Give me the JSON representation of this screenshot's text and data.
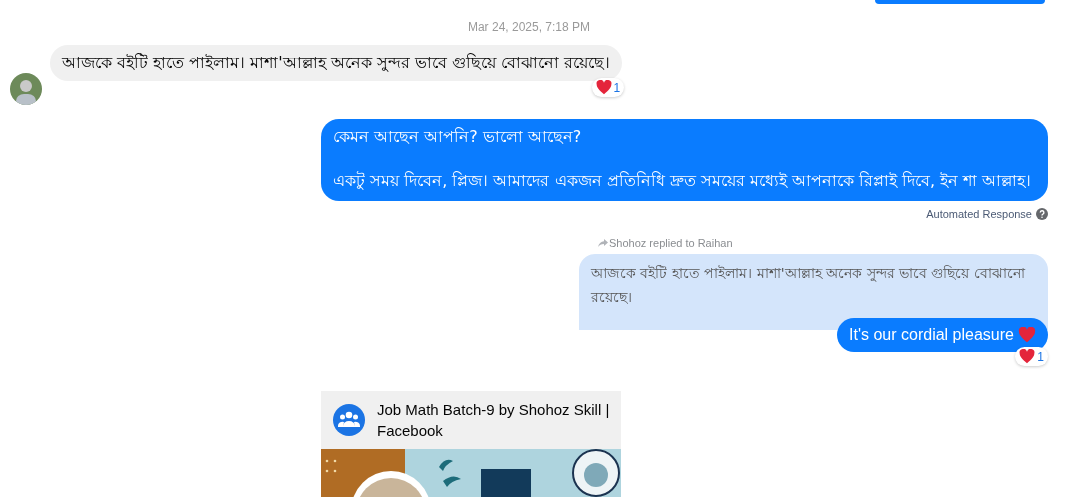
{
  "timestamp": "Mar 24, 2025, 7:18 PM",
  "messages": [
    {
      "kind": "tail"
    },
    {
      "kind": "incoming",
      "text": "আজকে বইটি হাতে পাইলাম। মাশা'আল্লাহ অনেক সুন্দর ভাবে গুছিয়ে বোঝানো রয়েছে।",
      "reaction_count": "1"
    },
    {
      "kind": "outgoing",
      "paragraphs": [
        "কেমন আছেন আপনি? ভালো আছেন?",
        "একটু সময় দিবেন, প্লিজ। আমাদের একজন প্রতিনিধি দ্রুত সময়ের মধ্যেই আপনাকে রিপ্লাই দিবে, ইন শা আল্লাহ।"
      ],
      "note": "Automated Response"
    },
    {
      "kind": "reply",
      "header": "Shohoz replied to Raihan",
      "quoted": "আজকে বইটি হাতে পাইলাম। মাশা'আল্লাহ অনেক সুন্দর ভাবে গুছিয়ে বোঝানো রয়েছে।",
      "text": "It's our cordial pleasure",
      "reaction_count": "1"
    },
    {
      "kind": "link",
      "title": "Job Math Batch-9 by Shohoz Skill | Facebook"
    }
  ]
}
